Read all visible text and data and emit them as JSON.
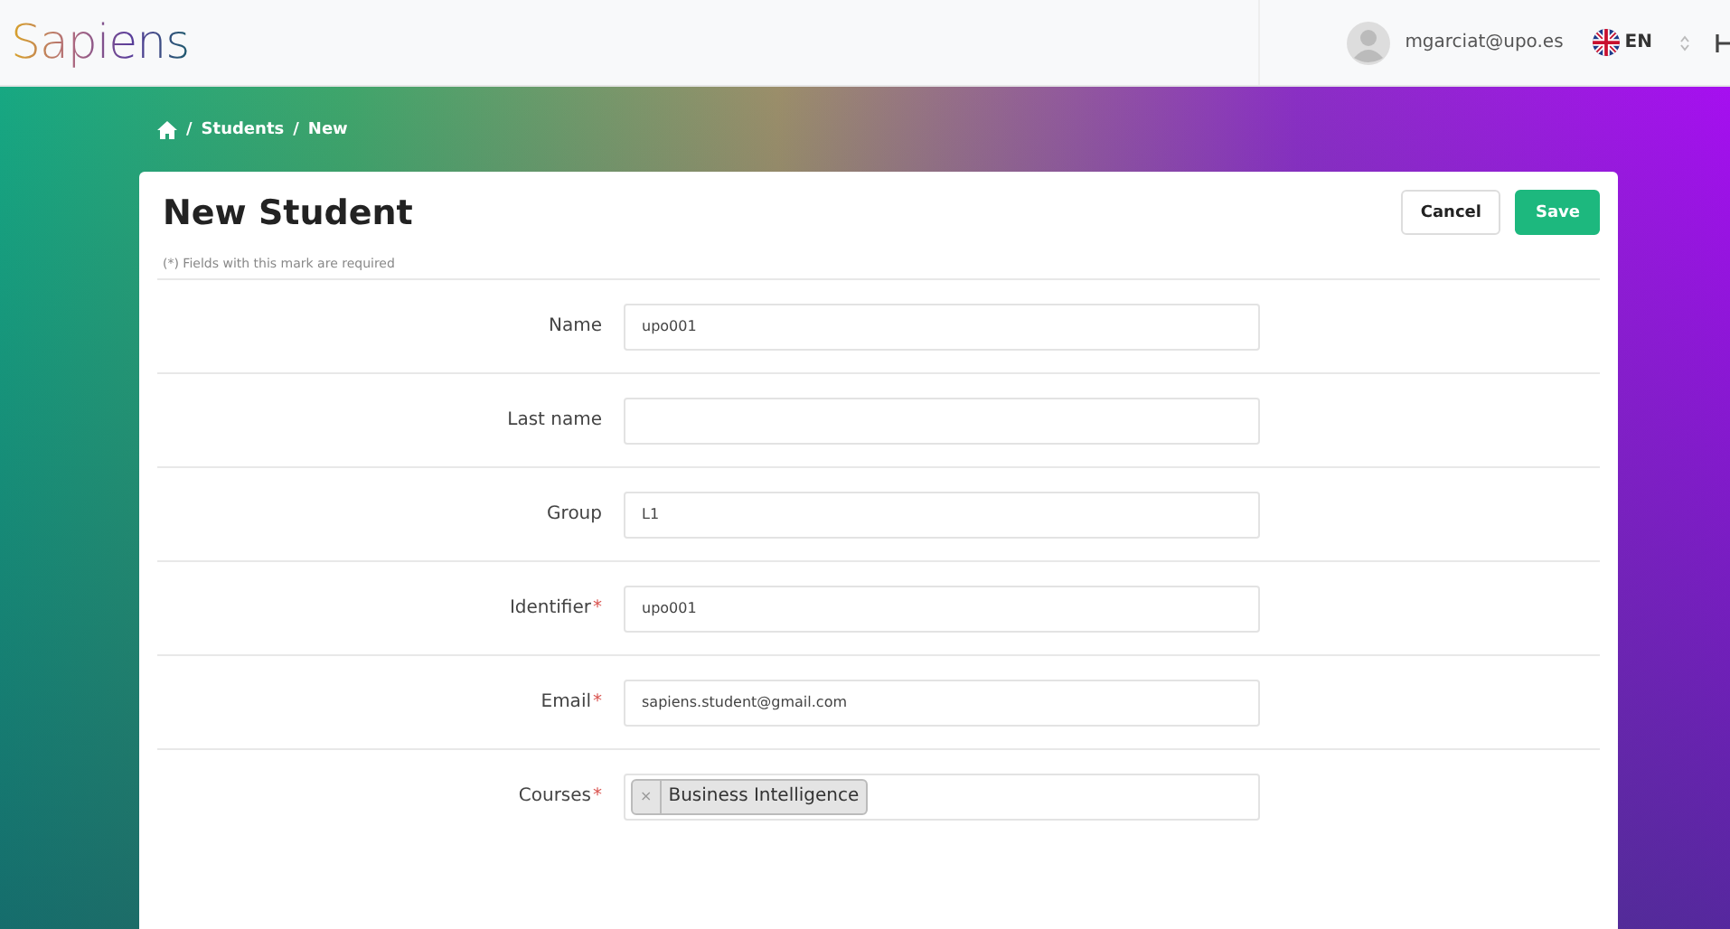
{
  "header": {
    "logo": "Sapiens",
    "user_email": "mgarciat@upo.es",
    "language": "EN"
  },
  "breadcrumb": {
    "separator": "/",
    "items": [
      "Students",
      "New"
    ]
  },
  "form": {
    "title": "New Student",
    "note": "(*) Fields with this mark are required",
    "buttons": [
      {
        "label": "Cancel",
        "kind": "secondary"
      },
      {
        "label": "Save",
        "kind": "primary"
      }
    ],
    "fields": [
      {
        "label": "Name",
        "kind": "text",
        "value": "upo001"
      },
      {
        "label": "Last name",
        "kind": "text"
      },
      {
        "label": "Group",
        "kind": "text",
        "value": "L1"
      },
      {
        "label": "Identifier",
        "mark": "*",
        "kind": "text",
        "value": "upo001"
      },
      {
        "label": "Email",
        "mark": "*",
        "kind": "text",
        "value": "sapiens.student@gmail.com"
      },
      {
        "label": "Courses",
        "mark": "*",
        "kind": "tags",
        "tags": [
          {
            "remove": "×",
            "label": "Business Intelligence"
          }
        ]
      }
    ]
  }
}
